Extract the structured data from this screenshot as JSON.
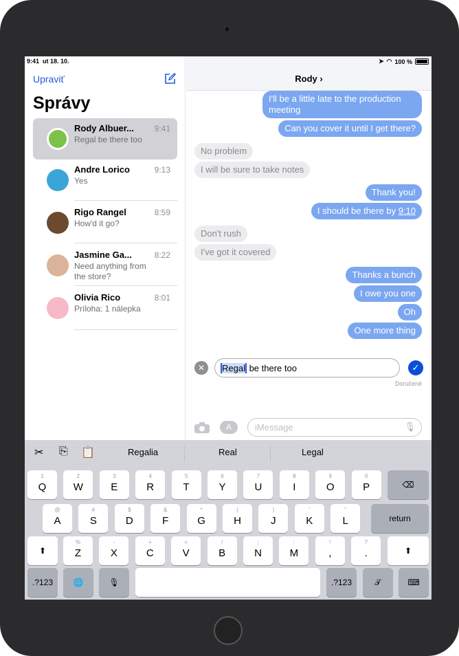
{
  "status": {
    "time": "9:41",
    "date": "ut 18. 10.",
    "battery": "100 %",
    "battery_level": 1.0
  },
  "sidebar": {
    "edit": "Upraviť",
    "title": "Správy",
    "compose_icon": "compose-icon",
    "conversations": [
      {
        "name": "Rody Albuer...",
        "time": "9:41",
        "preview": "Regal be there too",
        "selected": true,
        "avatar_color": "#7cc24a"
      },
      {
        "name": "Andre Lorico",
        "time": "9:13",
        "preview": "Yes",
        "avatar_color": "#3aa5d8"
      },
      {
        "name": "Rigo Rangel",
        "time": "8:59",
        "preview": "How'd it go?",
        "avatar_color": "#6b4a2e"
      },
      {
        "name": "Jasmine Ga...",
        "time": "8:22",
        "preview": "Need anything from the store?",
        "avatar_color": "#d9b49a"
      },
      {
        "name": "Olivia Rico",
        "time": "8:01",
        "preview": "Príloha: 1 nálepka",
        "avatar_color": "#f7b8c8"
      }
    ]
  },
  "header": {
    "contact": "Rody",
    "chevron": "›"
  },
  "messages": [
    {
      "from": "me",
      "text": "I'll be a little late to the production meeting",
      "gap": false
    },
    {
      "from": "me",
      "text": "Can you cover it until I get there?"
    },
    {
      "from": "them",
      "text": "No problem",
      "gap": true
    },
    {
      "from": "them",
      "text": "I will be sure to take notes"
    },
    {
      "from": "me",
      "text": "Thank you!",
      "gap": true
    },
    {
      "from": "me",
      "text": "I should be there by ",
      "link": "9:10"
    },
    {
      "from": "them",
      "text": "Don't rush",
      "gap": true
    },
    {
      "from": "them",
      "text": "I've got it covered"
    },
    {
      "from": "me",
      "text": "Thanks a bunch",
      "gap": true
    },
    {
      "from": "me",
      "text": "I owe you one"
    },
    {
      "from": "me",
      "text": "Oh"
    },
    {
      "from": "me",
      "text": "One more thing"
    }
  ],
  "editing": {
    "selected": "Regal",
    "rest": " be there too",
    "delivered": "Doručené"
  },
  "composer": {
    "placeholder": "iMessage"
  },
  "colors": {
    "accent": "#1f5bdb",
    "sent_bubble": "#7ba7f0",
    "received_bubble": "#ececee",
    "keyboard": "#d2d4d9"
  },
  "keyboard": {
    "suggestions": [
      "Regalia",
      "Real",
      "Legal"
    ],
    "rows": [
      [
        [
          "1",
          "Q"
        ],
        [
          "2",
          "W"
        ],
        [
          "3",
          "E"
        ],
        [
          "4",
          "R"
        ],
        [
          "5",
          "T"
        ],
        [
          "6",
          "Y"
        ],
        [
          "7",
          "U"
        ],
        [
          "8",
          "I"
        ],
        [
          "9",
          "O"
        ],
        [
          "0",
          "P"
        ]
      ],
      [
        [
          "@",
          "A"
        ],
        [
          "#",
          "S"
        ],
        [
          "$",
          "D"
        ],
        [
          "&",
          "F"
        ],
        [
          "*",
          "G"
        ],
        [
          "(",
          "H"
        ],
        [
          ")",
          "J"
        ],
        [
          "'",
          "K"
        ],
        [
          "\"",
          "L"
        ]
      ],
      [
        [
          "%",
          "Z"
        ],
        [
          "-",
          "X"
        ],
        [
          "+",
          "C"
        ],
        [
          "=",
          "V"
        ],
        [
          "/",
          "B"
        ],
        [
          ";",
          "N"
        ],
        [
          ":",
          "M"
        ],
        [
          "!",
          ","
        ],
        [
          "?",
          "."
        ]
      ]
    ],
    "delete": "⌫",
    "return": "return",
    "shift": "⬆",
    "numbers": ".?123",
    "globe": "🌐",
    "dictation": "🎙",
    "scribble": "𝒯",
    "hide": "⌨"
  }
}
